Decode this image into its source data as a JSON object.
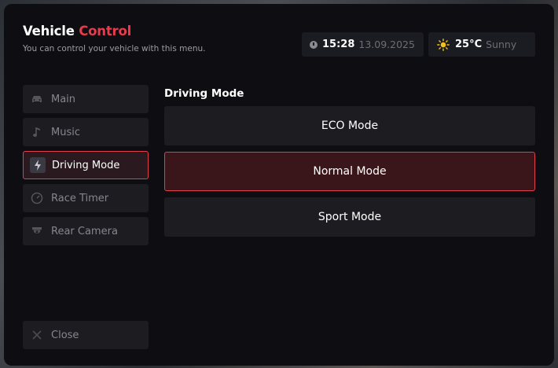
{
  "header": {
    "title_part1": "Vehicle",
    "title_part2": "Control",
    "subtitle": "You can control your vehicle with this menu."
  },
  "info": {
    "time": "15:28",
    "date": "13.09.2025",
    "temperature": "25°C",
    "weather": "Sunny"
  },
  "sidebar": {
    "items": [
      {
        "label": "Main",
        "icon": "car-icon"
      },
      {
        "label": "Music",
        "icon": "music-note-icon"
      },
      {
        "label": "Driving Mode",
        "icon": "lightning-icon"
      },
      {
        "label": "Race Timer",
        "icon": "speedometer-icon"
      },
      {
        "label": "Rear Camera",
        "icon": "camera-icon"
      }
    ],
    "close_label": "Close"
  },
  "content": {
    "title": "Driving Mode",
    "modes": [
      "ECO Mode",
      "Normal Mode",
      "Sport Mode"
    ],
    "selected_mode": "Normal Mode"
  },
  "colors": {
    "accent": "#ea3b4a",
    "panel": "#0e0e12",
    "item_bg": "#1c1c21"
  }
}
